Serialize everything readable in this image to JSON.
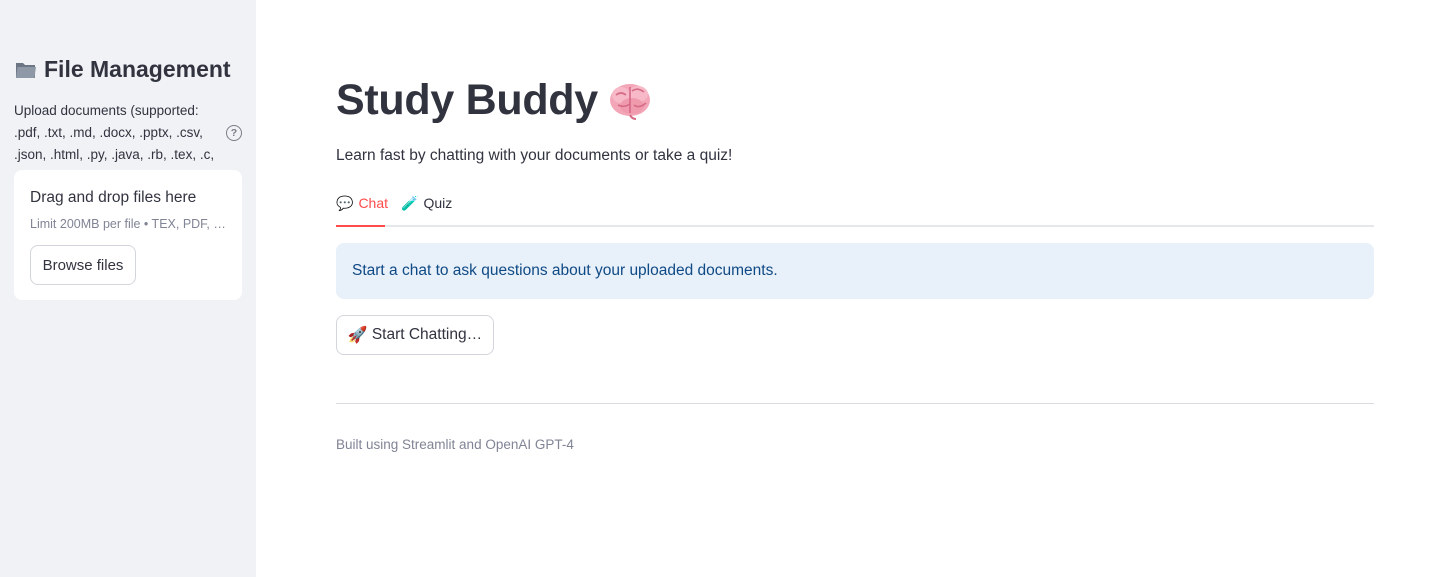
{
  "sidebar": {
    "title": "File Management",
    "upload_label": "Upload documents (supported: .pdf, .txt, .md, .docx, .pptx, .csv, .json, .html, .py, .java, .rb, .tex, .c, .cpp)",
    "help_icon": "?",
    "dropzone": {
      "title": "Drag and drop files here",
      "limit": "Limit 200MB per file • TEX, PDF, …",
      "browse_label": "Browse files"
    }
  },
  "main": {
    "title": "Study Buddy",
    "subtitle": "Learn fast by chatting with your documents or take a quiz!",
    "tabs": [
      {
        "icon": "💬",
        "label": "Chat",
        "active": true
      },
      {
        "icon": "🧪",
        "label": "Quiz",
        "active": false
      }
    ],
    "info": "Start a chat to ask questions about your uploaded documents.",
    "start_button": {
      "icon": "🚀",
      "label": "Start Chatting…"
    },
    "footer": "Built using Streamlit and OpenAI GPT-4"
  },
  "colors": {
    "accent": "#ff4b4b",
    "info_bg": "#e8f0fa",
    "info_text": "#0f4a85",
    "sidebar_bg": "#f0f2f6"
  }
}
